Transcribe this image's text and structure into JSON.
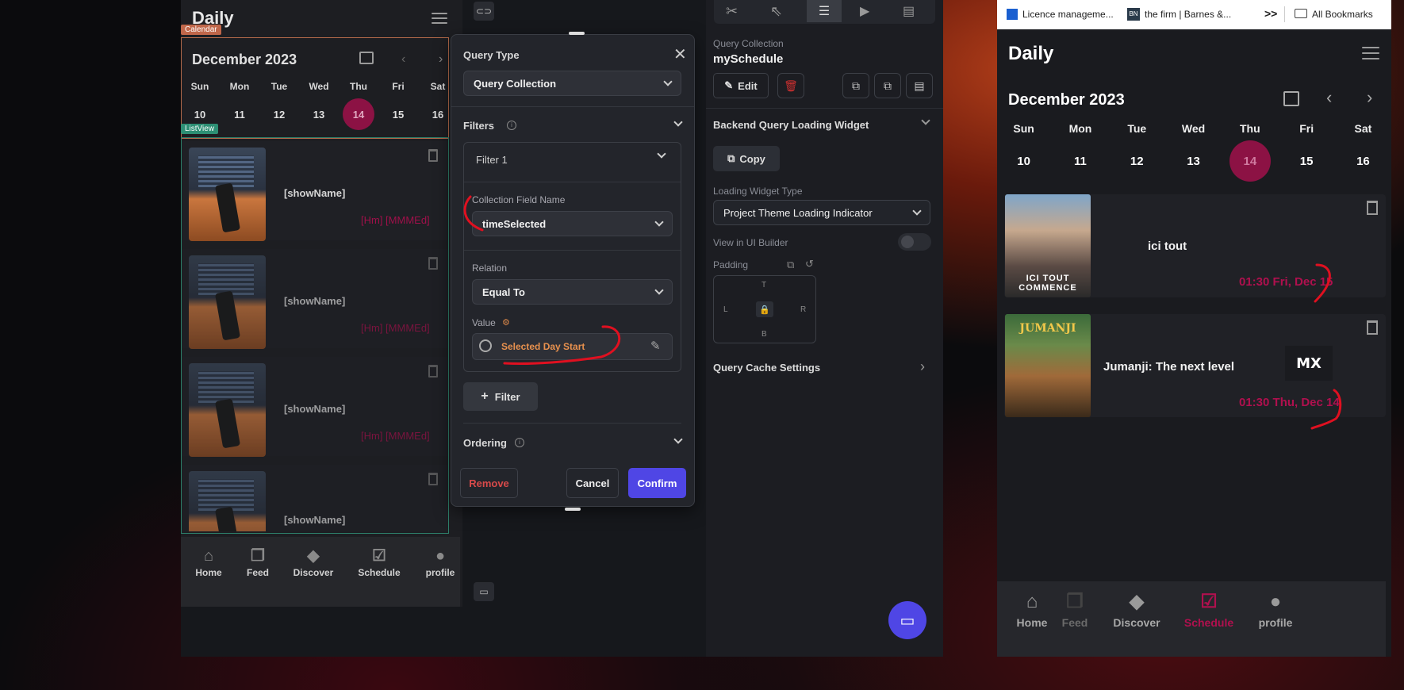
{
  "left_phone": {
    "title": "Daily",
    "calendar_tag": "Calendar",
    "listview_tag": "ListView",
    "month": "December 2023",
    "weekdays": [
      "Sun",
      "Mon",
      "Tue",
      "Wed",
      "Thu",
      "Fri",
      "Sat"
    ],
    "days": [
      "10",
      "11",
      "12",
      "13",
      "14",
      "15",
      "16"
    ],
    "items": [
      {
        "name": "[showName]",
        "time": "[Hm] [MMMEd]"
      },
      {
        "name": "[showName]",
        "time": "[Hm] [MMMEd]"
      },
      {
        "name": "[showName]",
        "time": "[Hm] [MMMEd]"
      },
      {
        "name": "[showName]",
        "time": ""
      }
    ],
    "nav": [
      "Home",
      "Feed",
      "Discover",
      "Schedule",
      "profile"
    ]
  },
  "dialog": {
    "query_type_label": "Query Type",
    "query_type_value": "Query Collection",
    "filters_label": "Filters",
    "filter1": "Filter 1",
    "field_name_label": "Collection Field Name",
    "field_name_value": "timeSelected",
    "relation_label": "Relation",
    "relation_value": "Equal To",
    "value_label": "Value",
    "value_value": "Selected Day Start",
    "add_filter": "Filter",
    "ordering_label": "Ordering",
    "remove": "Remove",
    "cancel": "Cancel",
    "confirm": "Confirm"
  },
  "props": {
    "qc_label": "Query Collection",
    "qc_name": "mySchedule",
    "edit": "Edit",
    "backend_loading": "Backend Query Loading Widget",
    "copy": "Copy",
    "loading_type_label": "Loading Widget Type",
    "loading_type_value": "Project Theme Loading Indicator",
    "view_ui_builder": "View in UI Builder",
    "padding": "Padding",
    "pad_t": "T",
    "pad_l": "L",
    "pad_r": "R",
    "pad_b": "B",
    "cache": "Query Cache Settings"
  },
  "bookmarks": {
    "items": [
      "Licence manageme...",
      "the firm | Barnes &...",
      ">>",
      "All Bookmarks"
    ]
  },
  "right_phone": {
    "title": "Daily",
    "month": "December 2023",
    "weekdays": [
      "Sun",
      "Mon",
      "Tue",
      "Wed",
      "Thu",
      "Fri",
      "Sat"
    ],
    "days": [
      "10",
      "11",
      "12",
      "13",
      "14",
      "15",
      "16"
    ],
    "items": [
      {
        "name": "ici tout",
        "time": "01:30 Fri, Dec 15",
        "poster_text": "ICI TOUT COMMENCE"
      },
      {
        "name": "Jumanji: The next level",
        "time": "01:30 Thu, Dec 14",
        "poster_text": "JUMANJI"
      }
    ],
    "nav": [
      "Home",
      "Feed",
      "Discover",
      "Schedule",
      "profile"
    ],
    "accent": "#b0104e"
  }
}
